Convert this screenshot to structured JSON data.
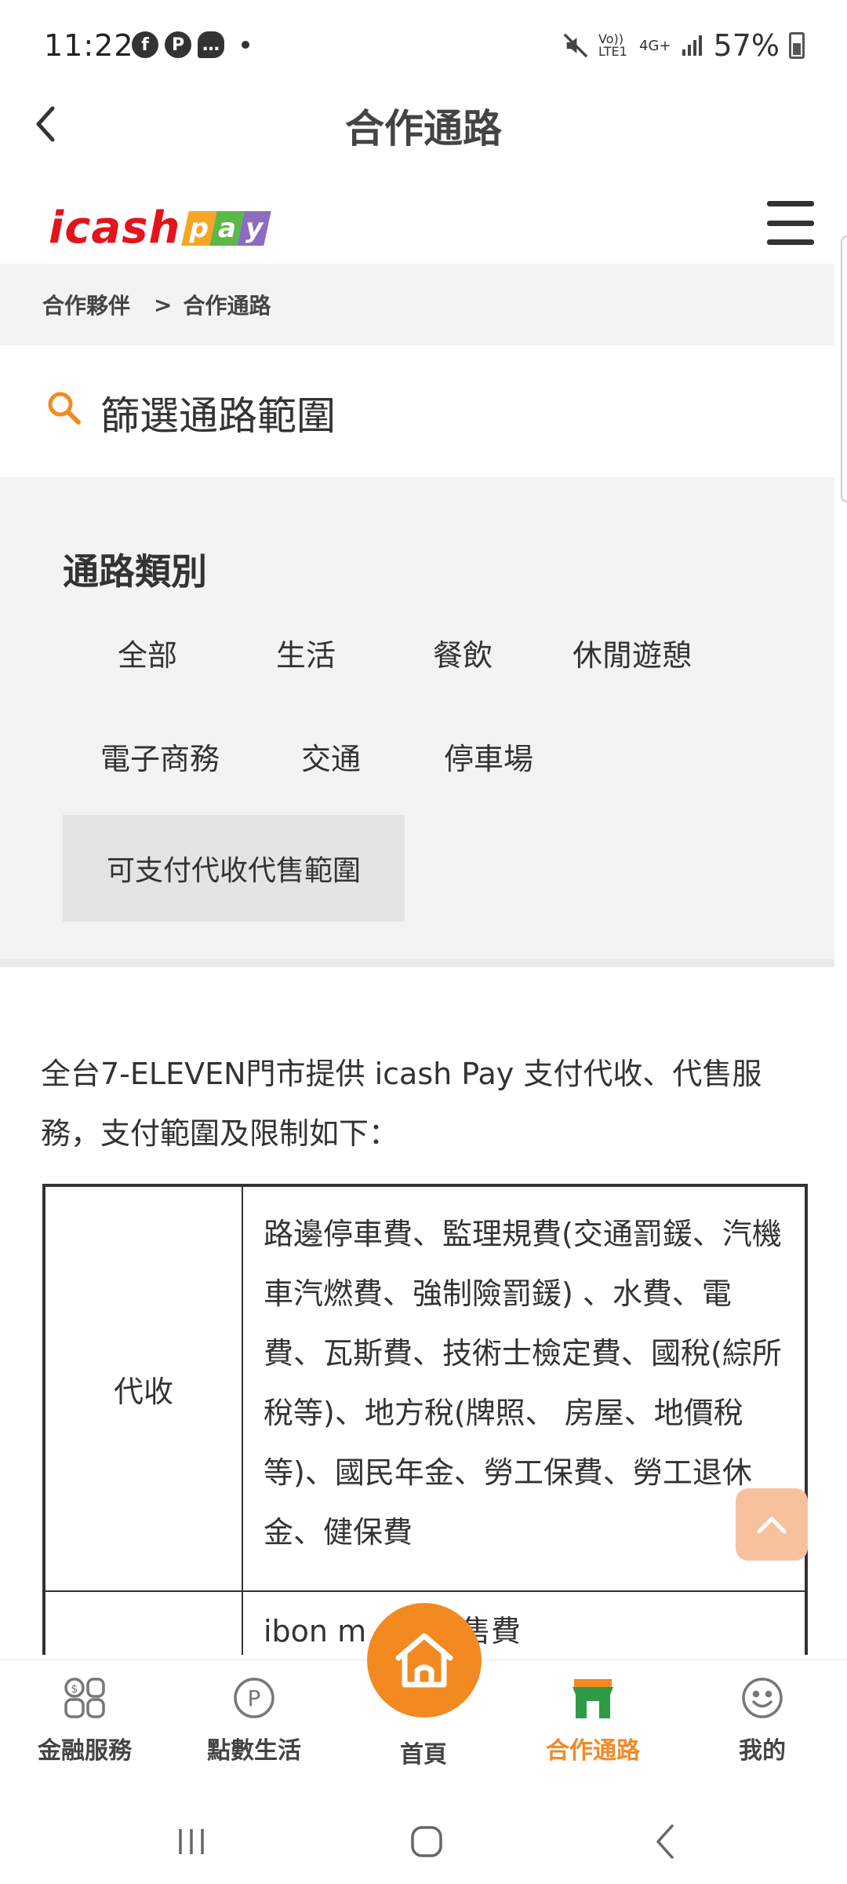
{
  "status_bar": {
    "time": "11:22",
    "left_icons": [
      "facebook-icon",
      "pixnet-icon",
      "chat-icon"
    ],
    "volte": "Vo)) LTE1",
    "network": "4G+",
    "battery_percent": "57%"
  },
  "title_bar": {
    "title": "合作通路"
  },
  "brand": {
    "logo_text": "icash",
    "logo_pay_letters": [
      "p",
      "a",
      "y"
    ],
    "pay_colors": [
      "#f6a623",
      "#5bb84a",
      "#8e6bbf"
    ],
    "logo_color": "#e3141c"
  },
  "breadcrumb": {
    "items": [
      "合作夥伴",
      "合作通路"
    ],
    "separator": ">"
  },
  "filter": {
    "title": "篩選通路範圍",
    "heading": "通路類別",
    "categories": [
      "全部",
      "生活",
      "餐飲",
      "休閒遊憩",
      "電子商務",
      "交通",
      "停車場"
    ],
    "special_category": "可支付代收代售範圍"
  },
  "content": {
    "intro": "全台7-ELEVEN門市提供 icash Pay 支付代收、代售服務，支付範圍及限制如下：",
    "table": [
      {
        "label": "代收",
        "value": "路邊停車費、監理規費(交通罰鍰、汽機車汽燃費、強制險罰鍰) 、水費、電費、瓦斯費、技術士檢定費、國稅(綜所稅等)、地方稅(牌照、 房屋、地價稅等)、國民年金、勞工保費、勞工退休金、健保費"
      },
      {
        "label": "",
        "value": "ibon m          售費"
      }
    ]
  },
  "bottom_nav": {
    "items": [
      {
        "label": "金融服務",
        "icon": "finance-icon"
      },
      {
        "label": "點數生活",
        "icon": "points-icon"
      },
      {
        "label": "首頁",
        "icon": "home-icon"
      },
      {
        "label": "合作通路",
        "icon": "store-icon"
      },
      {
        "label": "我的",
        "icon": "smiley-icon"
      }
    ],
    "active": "合作通路",
    "accent": "#f28a21"
  }
}
